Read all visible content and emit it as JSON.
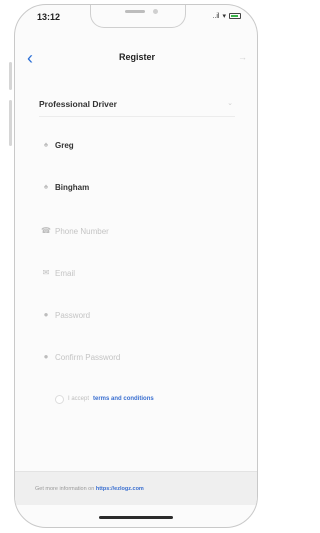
{
  "status_bar": {
    "time": "13:12",
    "signal": "..il",
    "wifi": "wifi-icon",
    "battery": "battery-icon"
  },
  "navbar": {
    "title": "Register",
    "back_icon": "back-chevron-icon",
    "next_icon": "forward-arrow-icon"
  },
  "account_type": {
    "value": "Professional Driver",
    "chevron": "chevron-down-icon"
  },
  "form": {
    "first_name": {
      "value": "Greg",
      "placeholder": "",
      "icon": "person-icon"
    },
    "last_name": {
      "value": "Bingham",
      "placeholder": "",
      "icon": "person-icon"
    },
    "phone": {
      "value": "",
      "placeholder": "Phone Number",
      "icon": "phone-icon"
    },
    "email": {
      "value": "",
      "placeholder": "Email",
      "icon": "mail-icon"
    },
    "password": {
      "value": "",
      "placeholder": "Password",
      "icon": "lock-icon"
    },
    "confirm_password": {
      "value": "",
      "placeholder": "Confirm Password",
      "icon": "lock-icon"
    }
  },
  "terms": {
    "prefix": "I accept",
    "link": "terms and conditions"
  },
  "footer": {
    "text": "Get more information on",
    "link": "https://ezlogz.com"
  },
  "colors": {
    "accent": "#2b6fd6",
    "link": "#3a6fd0",
    "footer_bg": "#efefef"
  }
}
